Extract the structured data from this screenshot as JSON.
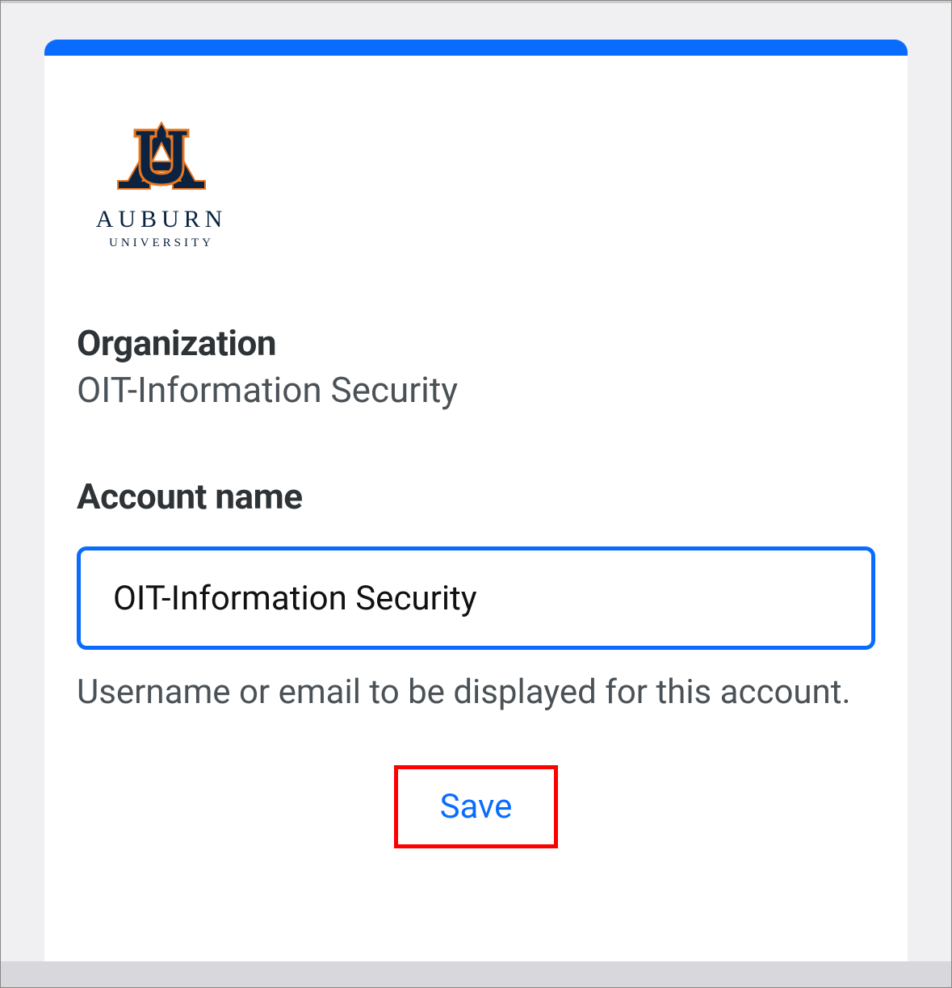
{
  "logo": {
    "name": "AUBURN",
    "subtitle": "UNIVERSITY"
  },
  "organization": {
    "label": "Organization",
    "value": "OIT-Information Security"
  },
  "account": {
    "label": "Account name",
    "input_value": "OIT-Information Security",
    "helper": "Username or email to be displayed for this account."
  },
  "actions": {
    "save_label": "Save"
  },
  "colors": {
    "accent": "#0a6cff",
    "highlight_border": "#ff0000"
  }
}
